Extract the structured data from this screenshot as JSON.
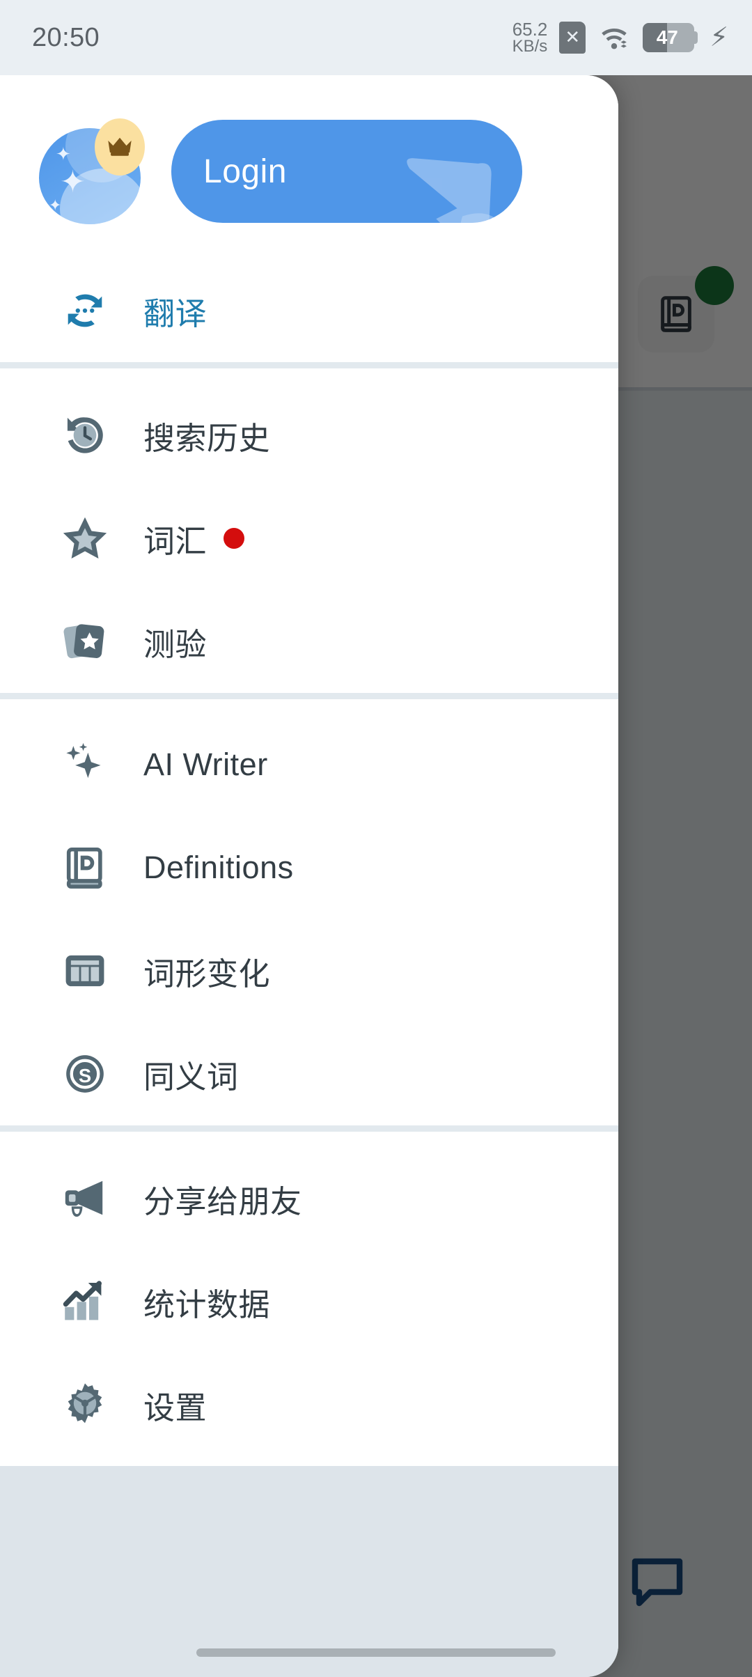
{
  "status_bar": {
    "clock": "20:50",
    "net_speed_value": "65.2",
    "net_speed_unit": "KB/s",
    "sim_icon": "sim-card-disabled-icon",
    "wifi_icon": "wifi-icon",
    "battery_level": "47",
    "battery_percent": 47,
    "charging_icon": "charging-bolt-icon",
    "background": "#eaeff3"
  },
  "drawer": {
    "header": {
      "avatar_name": "user-avatar",
      "premium_badge_icon": "crown-icon",
      "login_label": "Login",
      "login_accent": "#4f96e8",
      "hand_icon": "pointing-hand-icon"
    },
    "sections": [
      {
        "items": [
          {
            "label": "翻译",
            "icon": "translate-icon",
            "active": true,
            "badge": null
          }
        ]
      },
      {
        "items": [
          {
            "label": "搜索历史",
            "icon": "history-clock-icon",
            "active": false,
            "badge": null
          },
          {
            "label": "词汇",
            "icon": "star-icon",
            "active": false,
            "badge": "red-dot"
          },
          {
            "label": "测验",
            "icon": "flashcards-star-icon",
            "active": false,
            "badge": null
          }
        ]
      },
      {
        "items": [
          {
            "label": "AI Writer",
            "icon": "sparkle-icon",
            "active": false,
            "badge": null
          },
          {
            "label": "Definitions",
            "icon": "dictionary-book-icon",
            "active": false,
            "badge": null
          },
          {
            "label": "词形变化",
            "icon": "inflection-table-icon",
            "active": false,
            "badge": null
          },
          {
            "label": "同义词",
            "icon": "synonym-circle-s-icon",
            "active": false,
            "badge": null
          }
        ]
      },
      {
        "items": [
          {
            "label": "分享给朋友",
            "icon": "megaphone-icon",
            "active": false,
            "badge": null
          },
          {
            "label": "统计数据",
            "icon": "statistics-chart-icon",
            "active": false,
            "badge": null
          },
          {
            "label": "设置",
            "icon": "gear-icon",
            "active": false,
            "badge": null
          }
        ]
      }
    ],
    "active_color": "#1f7cad",
    "label_color": "#333d44",
    "badge_color": "#d40d0d",
    "footer_color": "#dde4ea"
  },
  "background_app": {
    "dictionary_button_icon": "dictionary-book-icon",
    "status_dot_color": "#1c7a3a",
    "fab_icon": "chat-bubble-icon",
    "scrim_opacity": 0.56
  },
  "navigation_bar": {
    "gesture_pill": "home-gesture-pill"
  }
}
